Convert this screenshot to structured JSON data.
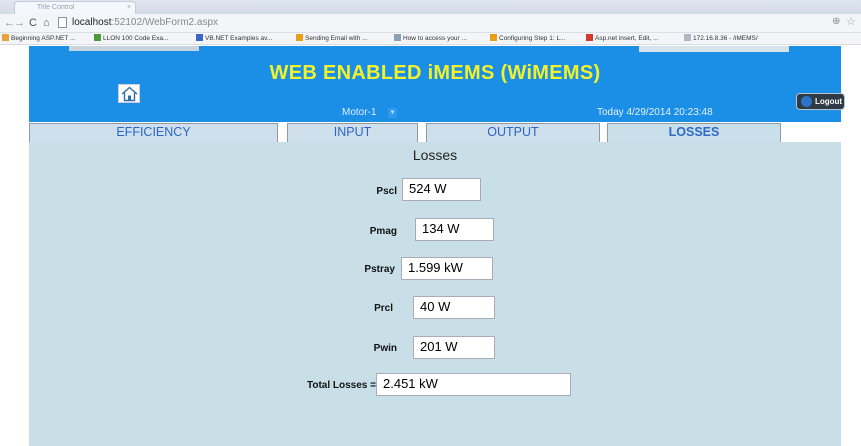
{
  "browser": {
    "tab_title": "Title Control",
    "tab_close": "×",
    "nav_back": "←",
    "nav_forward": "→",
    "nav_reload": "C",
    "nav_home": "⌂",
    "url_host": "localhost",
    "url_rest": ":52102/WebForm2.aspx",
    "zoom_icon": "⊕",
    "star_icon": "☆",
    "bookmarks": [
      {
        "label": "Beginning ASP.NET ...",
        "icon_color": "#e8a33a"
      },
      {
        "label": "LLON 100 Code Exa...",
        "icon_color": "#4c9a3a"
      },
      {
        "label": "VB.NET Examples av...",
        "icon_color": "#3b67c9"
      },
      {
        "label": "Sending Email with ...",
        "icon_color": "#e6a016"
      },
      {
        "label": "How to access your ...",
        "icon_color": "#8aa0b5"
      },
      {
        "label": "Configuring Step 1: L...",
        "icon_color": "#e6a016"
      },
      {
        "label": "Asp.net insert, Edit, ...",
        "icon_color": "#d33a2f"
      },
      {
        "label": "172.16.8.36 - /iMEMS/",
        "icon_color": "#b0b8c2"
      }
    ]
  },
  "header": {
    "title": "WEB ENABLED iMEMS (WiMEMS)",
    "motor_selected": "Motor-1",
    "datetime": "Today 4/29/2014 20:23:48",
    "logout_label": "Logout",
    "brand_color": "#1b8ee6",
    "title_color": "#f2f22a"
  },
  "tabs": [
    {
      "label": "EFFICIENCY",
      "active": false
    },
    {
      "label": "INPUT",
      "active": false
    },
    {
      "label": "OUTPUT",
      "active": false
    },
    {
      "label": "LOSSES",
      "active": true
    }
  ],
  "losses": {
    "title": "Losses",
    "rows": [
      {
        "label": "Pscl",
        "value": "524 W"
      },
      {
        "label": "Pmag",
        "value": "134 W"
      },
      {
        "label": "Pstray",
        "value": "1.599 kW"
      },
      {
        "label": "Prcl",
        "value": "40 W"
      },
      {
        "label": "Pwin",
        "value": "201 W"
      }
    ],
    "total_label": "Total Losses =",
    "total_value": "2.451 kW"
  }
}
